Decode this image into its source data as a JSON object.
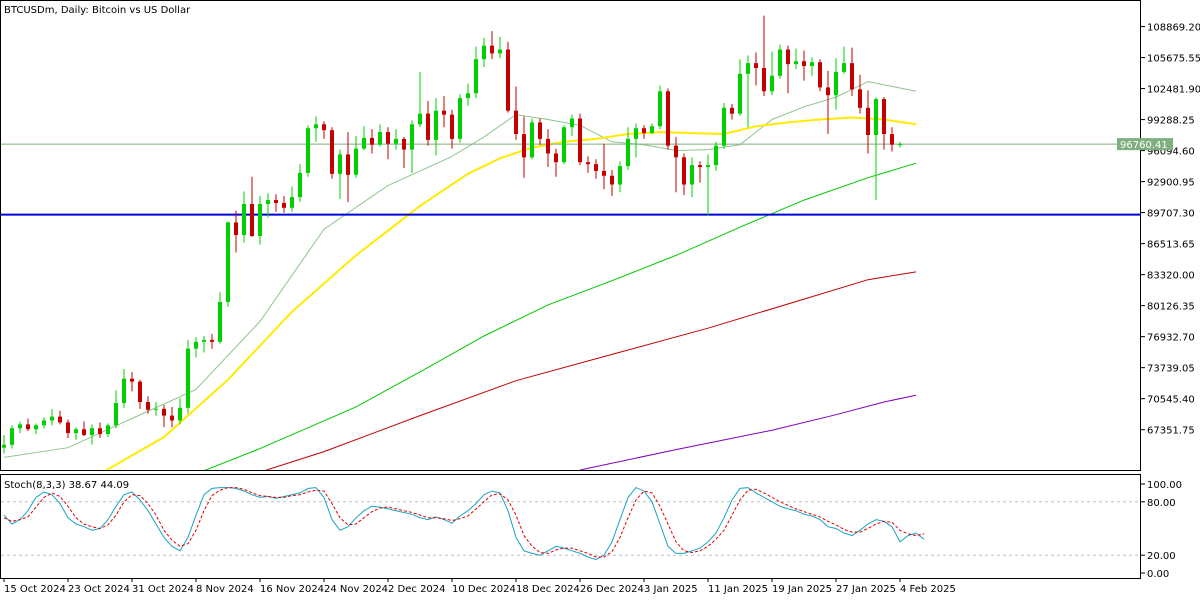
{
  "chart_data": {
    "type": "candlestick",
    "title": "BTCUSDm, Daily: Bitcoin vs US Dollar",
    "colors": {
      "background": "#ffffff",
      "bull": "#00d000",
      "bear": "#c40000",
      "frame": "#000000",
      "current_price_line": "#7fae7f",
      "level_line": "#0000d8",
      "stoch_main": "#1aa3c4",
      "stoch_signal": "#e00000",
      "stoch_levels": "#bfbfbf"
    },
    "y_axis": {
      "range": [
        63200,
        111500
      ],
      "ticks": [
        "108869.20",
        "105675.55",
        "102481.90",
        "99288.25",
        "96094.60",
        "92900.95",
        "89707.30",
        "86513.65",
        "83320.00",
        "80126.35",
        "76932.70",
        "73739.05",
        "70545.40",
        "67351.75"
      ]
    },
    "current_price": {
      "value": 96760.41,
      "label": "96760.41"
    },
    "horizontal_level": {
      "value": 89500
    },
    "x_axis": {
      "labels": [
        {
          "index": 0,
          "text": "15 Oct 2024"
        },
        {
          "index": 8,
          "text": "23 Oct 2024"
        },
        {
          "index": 16,
          "text": "31 Oct 2024"
        },
        {
          "index": 24,
          "text": "8 Nov 2024"
        },
        {
          "index": 32,
          "text": "16 Nov 2024"
        },
        {
          "index": 40,
          "text": "24 Nov 2024"
        },
        {
          "index": 48,
          "text": "2 Dec 2024"
        },
        {
          "index": 56,
          "text": "10 Dec 2024"
        },
        {
          "index": 64,
          "text": "18 Dec 2024"
        },
        {
          "index": 72,
          "text": "26 Dec 2024"
        },
        {
          "index": 80,
          "text": "3 Jan 2025"
        },
        {
          "index": 88,
          "text": "11 Jan 2025"
        },
        {
          "index": 96,
          "text": "19 Jan 2025"
        },
        {
          "index": 104,
          "text": "27 Jan 2025"
        },
        {
          "index": 112,
          "text": "4 Feb 2025"
        }
      ]
    },
    "candles": [
      [
        65500,
        66800,
        64900,
        65800
      ],
      [
        65800,
        67800,
        65400,
        67500
      ],
      [
        67500,
        68200,
        67000,
        67900
      ],
      [
        67900,
        68500,
        67200,
        67400
      ],
      [
        67400,
        68000,
        66900,
        67800
      ],
      [
        67800,
        68600,
        67500,
        68300
      ],
      [
        68300,
        69500,
        67800,
        68700
      ],
      [
        68700,
        69300,
        67900,
        68100
      ],
      [
        68100,
        68400,
        66500,
        67000
      ],
      [
        67000,
        67600,
        66300,
        67400
      ],
      [
        67400,
        68200,
        66700,
        66800
      ],
      [
        66800,
        67900,
        65800,
        67500
      ],
      [
        67500,
        68100,
        66500,
        66900
      ],
      [
        66900,
        68000,
        66600,
        67800
      ],
      [
        67800,
        71400,
        67500,
        70100
      ],
      [
        70100,
        73600,
        69600,
        72600
      ],
      [
        72600,
        73300,
        71300,
        72300
      ],
      [
        72300,
        72500,
        69500,
        70200
      ],
      [
        70200,
        70800,
        69000,
        69400
      ],
      [
        69400,
        70200,
        68800,
        69500
      ],
      [
        69500,
        69900,
        67600,
        68800
      ],
      [
        68800,
        69700,
        67600,
        68300
      ],
      [
        68300,
        70600,
        67900,
        69600
      ],
      [
        69600,
        76600,
        69000,
        75700
      ],
      [
        75700,
        76900,
        74800,
        76400
      ],
      [
        76400,
        77000,
        75300,
        76600
      ],
      [
        76600,
        77200,
        75700,
        76400
      ],
      [
        76400,
        81500,
        76200,
        80500
      ],
      [
        80500,
        88800,
        80000,
        88700
      ],
      [
        88700,
        89900,
        85600,
        87400
      ],
      [
        87400,
        91900,
        86600,
        90600
      ],
      [
        90600,
        93400,
        87200,
        87300
      ],
      [
        87300,
        91400,
        86400,
        90600
      ],
      [
        90600,
        91700,
        89200,
        91000
      ],
      [
        91000,
        91600,
        89800,
        90700
      ],
      [
        90700,
        91400,
        89700,
        90200
      ],
      [
        90200,
        92400,
        89800,
        91300
      ],
      [
        91300,
        94700,
        90800,
        93800
      ],
      [
        93800,
        98700,
        93400,
        98400
      ],
      [
        98400,
        99600,
        97000,
        98800
      ],
      [
        98800,
        99100,
        97300,
        98200
      ],
      [
        98200,
        98500,
        93200,
        93700
      ],
      [
        93700,
        96200,
        91100,
        95700
      ],
      [
        95700,
        98000,
        90800,
        93600
      ],
      [
        93600,
        97600,
        93300,
        96300
      ],
      [
        96300,
        98600,
        96100,
        97400
      ],
      [
        97400,
        98300,
        95800,
        96700
      ],
      [
        96700,
        98800,
        96500,
        98000
      ],
      [
        98000,
        98500,
        95200,
        96800
      ],
      [
        96800,
        98300,
        96200,
        97300
      ],
      [
        97300,
        97500,
        94300,
        96200
      ],
      [
        96200,
        99200,
        93800,
        98800
      ],
      [
        98800,
        104200,
        98500,
        99900
      ],
      [
        99900,
        101200,
        96600,
        97200
      ],
      [
        97200,
        101500,
        95600,
        100200
      ],
      [
        100200,
        101700,
        98500,
        99800
      ],
      [
        99800,
        100300,
        96300,
        97300
      ],
      [
        97300,
        101900,
        96900,
        101500
      ],
      [
        101500,
        103000,
        100700,
        102000
      ],
      [
        102000,
        106800,
        101500,
        105500
      ],
      [
        105500,
        107700,
        104700,
        106900
      ],
      [
        106900,
        108400,
        105500,
        106100
      ],
      [
        106100,
        107800,
        105600,
        106500
      ],
      [
        106500,
        107300,
        100000,
        100200
      ],
      [
        100200,
        102700,
        97200,
        97800
      ],
      [
        97800,
        99600,
        93300,
        95400
      ],
      [
        95400,
        99400,
        95200,
        99000
      ],
      [
        99000,
        99400,
        96700,
        97300
      ],
      [
        97300,
        98300,
        94400,
        95800
      ],
      [
        95800,
        96300,
        93400,
        94900
      ],
      [
        94900,
        98700,
        94700,
        98500
      ],
      [
        98500,
        99800,
        97600,
        99400
      ],
      [
        99400,
        99900,
        94600,
        94900
      ],
      [
        94900,
        95500,
        93800,
        94700
      ],
      [
        94700,
        95200,
        93200,
        94000
      ],
      [
        94000,
        96800,
        92100,
        93500
      ],
      [
        93500,
        94100,
        91400,
        92600
      ],
      [
        92600,
        95000,
        91800,
        94500
      ],
      [
        94500,
        98500,
        94100,
        97300
      ],
      [
        97300,
        98900,
        95400,
        98400
      ],
      [
        98400,
        98700,
        97300,
        97900
      ],
      [
        97900,
        98900,
        97800,
        98600
      ],
      [
        98600,
        102800,
        98300,
        102200
      ],
      [
        102200,
        102500,
        96200,
        96600
      ],
      [
        96600,
        97500,
        91800,
        95400
      ],
      [
        95400,
        95800,
        91500,
        92600
      ],
      [
        92600,
        95400,
        91300,
        94600
      ],
      [
        94600,
        95000,
        92800,
        94400
      ],
      [
        94400,
        95700,
        89400,
        94600
      ],
      [
        94600,
        97000,
        94000,
        96600
      ],
      [
        96600,
        101000,
        96300,
        100500
      ],
      [
        100500,
        100900,
        99300,
        99900
      ],
      [
        99900,
        105500,
        99700,
        104000
      ],
      [
        104000,
        105900,
        98500,
        105100
      ],
      [
        105100,
        106200,
        102800,
        104600
      ],
      [
        104600,
        110000,
        101700,
        102200
      ],
      [
        102200,
        106300,
        101800,
        103800
      ],
      [
        103800,
        107000,
        103500,
        106500
      ],
      [
        106500,
        106900,
        102000,
        105000
      ],
      [
        105000,
        106600,
        104500,
        105300
      ],
      [
        105300,
        106400,
        103300,
        104800
      ],
      [
        104800,
        105700,
        103800,
        105200
      ],
      [
        105200,
        105500,
        102200,
        102600
      ],
      [
        102600,
        104300,
        97800,
        101800
      ],
      [
        101800,
        105600,
        100300,
        104200
      ],
      [
        104200,
        106800,
        104000,
        105100
      ],
      [
        105100,
        106700,
        101700,
        102400
      ],
      [
        102400,
        103900,
        99900,
        100500
      ],
      [
        100500,
        102300,
        95800,
        97700
      ],
      [
        97700,
        101600,
        91000,
        101400
      ],
      [
        101400,
        101600,
        96200,
        97800
      ],
      [
        97800,
        98500,
        96000,
        96700
      ],
      [
        96700,
        97000,
        96400,
        96760.41
      ]
    ],
    "moving_averages": [
      {
        "color": "#8fc48f",
        "width": 1,
        "points": [
          [
            0,
            64500
          ],
          [
            8,
            65500
          ],
          [
            16,
            68500
          ],
          [
            24,
            71500
          ],
          [
            32,
            78500
          ],
          [
            40,
            88000
          ],
          [
            48,
            92500
          ],
          [
            56,
            95500
          ],
          [
            60,
            97500
          ],
          [
            64,
            99800
          ],
          [
            68,
            99300
          ],
          [
            72,
            98700
          ],
          [
            76,
            97000
          ],
          [
            80,
            96700
          ],
          [
            84,
            96100
          ],
          [
            88,
            96200
          ],
          [
            92,
            96700
          ],
          [
            96,
            99300
          ],
          [
            100,
            100600
          ],
          [
            104,
            101600
          ],
          [
            108,
            103200
          ],
          [
            111,
            102700
          ],
          [
            114,
            102200
          ]
        ]
      },
      {
        "color": "#ffeb00",
        "width": 2,
        "points": [
          [
            0,
            60800
          ],
          [
            12,
            62800
          ],
          [
            20,
            66600
          ],
          [
            28,
            72500
          ],
          [
            36,
            79500
          ],
          [
            44,
            85300
          ],
          [
            52,
            90400
          ],
          [
            58,
            93700
          ],
          [
            62,
            95300
          ],
          [
            66,
            96400
          ],
          [
            70,
            97000
          ],
          [
            74,
            97300
          ],
          [
            78,
            97800
          ],
          [
            82,
            98000
          ],
          [
            86,
            97900
          ],
          [
            90,
            97800
          ],
          [
            94,
            98600
          ],
          [
            98,
            99000
          ],
          [
            102,
            99300
          ],
          [
            106,
            99500
          ],
          [
            110,
            99300
          ],
          [
            114,
            98800
          ]
        ]
      },
      {
        "color": "#00c800",
        "width": 1,
        "points": [
          [
            0,
            57500
          ],
          [
            20,
            61500
          ],
          [
            32,
            65400
          ],
          [
            44,
            69700
          ],
          [
            52,
            73300
          ],
          [
            60,
            77000
          ],
          [
            68,
            80200
          ],
          [
            76,
            82700
          ],
          [
            84,
            85300
          ],
          [
            92,
            88200
          ],
          [
            100,
            91000
          ],
          [
            108,
            93300
          ],
          [
            114,
            94800
          ]
        ]
      },
      {
        "color": "#c00000",
        "width": 1,
        "points": [
          [
            0,
            55000
          ],
          [
            26,
            61400
          ],
          [
            40,
            65100
          ],
          [
            52,
            68800
          ],
          [
            64,
            72400
          ],
          [
            76,
            75100
          ],
          [
            88,
            77800
          ],
          [
            100,
            80800
          ],
          [
            108,
            82800
          ],
          [
            114,
            83600
          ]
        ]
      },
      {
        "color": "#8000c0",
        "width": 1,
        "points": [
          [
            72,
            63200
          ],
          [
            84,
            65300
          ],
          [
            96,
            67300
          ],
          [
            104,
            68900
          ],
          [
            110,
            70200
          ],
          [
            114,
            70900
          ]
        ]
      }
    ],
    "stochastic": {
      "label": "Stoch(8,3,3) 38.67 44.09",
      "y_range": [
        0,
        100
      ],
      "tick_labels": [
        {
          "value": 100,
          "text": "100.00"
        },
        {
          "value": 80,
          "text": "80.00"
        },
        {
          "value": 20,
          "text": "20.00"
        },
        {
          "value": 0,
          "text": "0.00"
        }
      ],
      "levels": [
        80,
        20
      ],
      "main": [
        65,
        55,
        60,
        70,
        85,
        91,
        88,
        78,
        62,
        55,
        52,
        48,
        50,
        60,
        75,
        88,
        91,
        82,
        70,
        55,
        40,
        30,
        25,
        40,
        65,
        88,
        95,
        96,
        96,
        95,
        92,
        88,
        85,
        86,
        84,
        86,
        88,
        90,
        95,
        96,
        85,
        60,
        48,
        52,
        62,
        70,
        75,
        74,
        72,
        70,
        68,
        66,
        62,
        60,
        63,
        60,
        56,
        64,
        70,
        78,
        88,
        92,
        90,
        70,
        40,
        25,
        22,
        20,
        25,
        30,
        28,
        25,
        22,
        18,
        15,
        20,
        35,
        60,
        85,
        96,
        92,
        80,
        55,
        30,
        22,
        22,
        25,
        28,
        35,
        45,
        62,
        82,
        95,
        96,
        90,
        85,
        80,
        75,
        72,
        70,
        66,
        64,
        60,
        52,
        50,
        45,
        42,
        48,
        55,
        60,
        58,
        52,
        35,
        42,
        45,
        38
      ],
      "signal": [
        62,
        58,
        60,
        63,
        74,
        85,
        90,
        86,
        75,
        62,
        55,
        52,
        50,
        54,
        65,
        80,
        88,
        87,
        78,
        65,
        48,
        37,
        30,
        33,
        48,
        70,
        87,
        93,
        96,
        96,
        94,
        90,
        87,
        86,
        85,
        85,
        87,
        88,
        91,
        93,
        92,
        78,
        62,
        54,
        55,
        62,
        69,
        73,
        74,
        72,
        70,
        68,
        65,
        62,
        62,
        61,
        59,
        61,
        64,
        72,
        80,
        88,
        89,
        82,
        65,
        42,
        30,
        23,
        22,
        26,
        28,
        28,
        25,
        22,
        18,
        18,
        24,
        40,
        62,
        82,
        92,
        90,
        75,
        55,
        35,
        25,
        23,
        25,
        30,
        38,
        48,
        65,
        82,
        93,
        94,
        90,
        85,
        80,
        76,
        72,
        69,
        66,
        63,
        58,
        54,
        49,
        46,
        46,
        50,
        55,
        58,
        57,
        48,
        44,
        42,
        44
      ]
    }
  }
}
